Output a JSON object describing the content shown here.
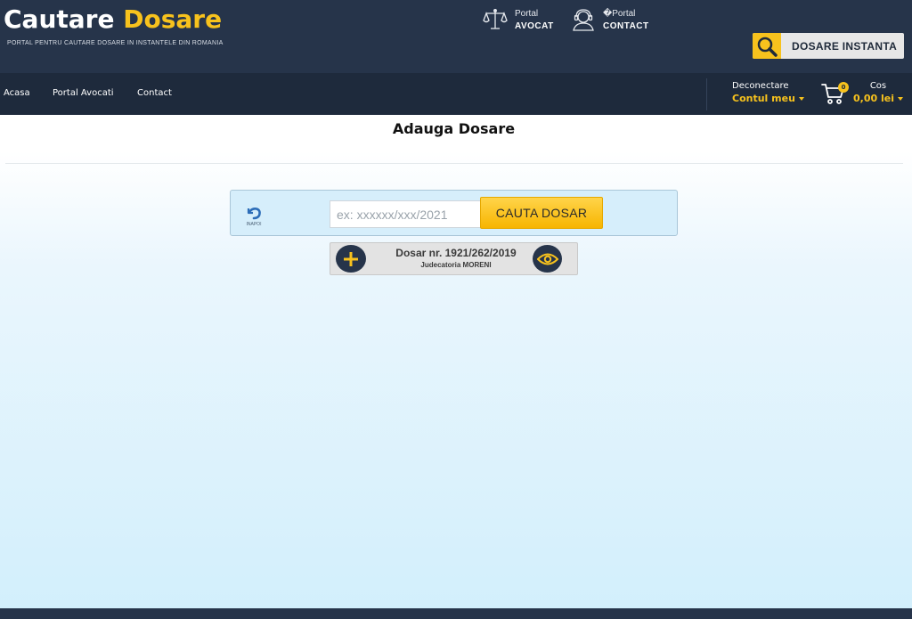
{
  "header": {
    "logo_main": "Cautare",
    "logo_accent": "Dosare",
    "tagline": "PORTAL PENTRU CAUTARE DOSARE IN INSTANTELE DIN ROMANIA",
    "portal_lawyer": {
      "line1": "Portal",
      "line2": "AVOCAT",
      "icon": "scales-icon"
    },
    "portal_contact": {
      "line1": "�Portal",
      "line2": "CONTACT",
      "icon": "user-headset-icon"
    },
    "instant_button": {
      "label": "DOSARE INSTANTA",
      "icon": "magnifier-icon"
    }
  },
  "nav": {
    "items": [
      "Acasa",
      "Portal Avocati",
      "Contact"
    ],
    "account": {
      "line1": "Deconectare",
      "line2": "Contul meu"
    },
    "cart": {
      "count": "0",
      "line1": "Cos",
      "line2": "0,00 lei",
      "icon": "cart-icon"
    }
  },
  "main": {
    "title": "Adauga Dosare",
    "back_label": "INAPOI",
    "search": {
      "placeholder": "ex: xxxxxx/xxx/2021",
      "value": "",
      "button_label": "CAUTA DOSAR"
    },
    "result": {
      "case_number": "Dosar nr. 1921/262/2019",
      "court": "Judecatoria MORENI",
      "add_icon": "plus-icon",
      "view_icon": "eye-icon"
    }
  },
  "colors": {
    "header_bg": "#26344a",
    "nav_bg": "#1e2a3c",
    "accent": "#f7c21d",
    "panel_bg": "#d6eefb"
  }
}
